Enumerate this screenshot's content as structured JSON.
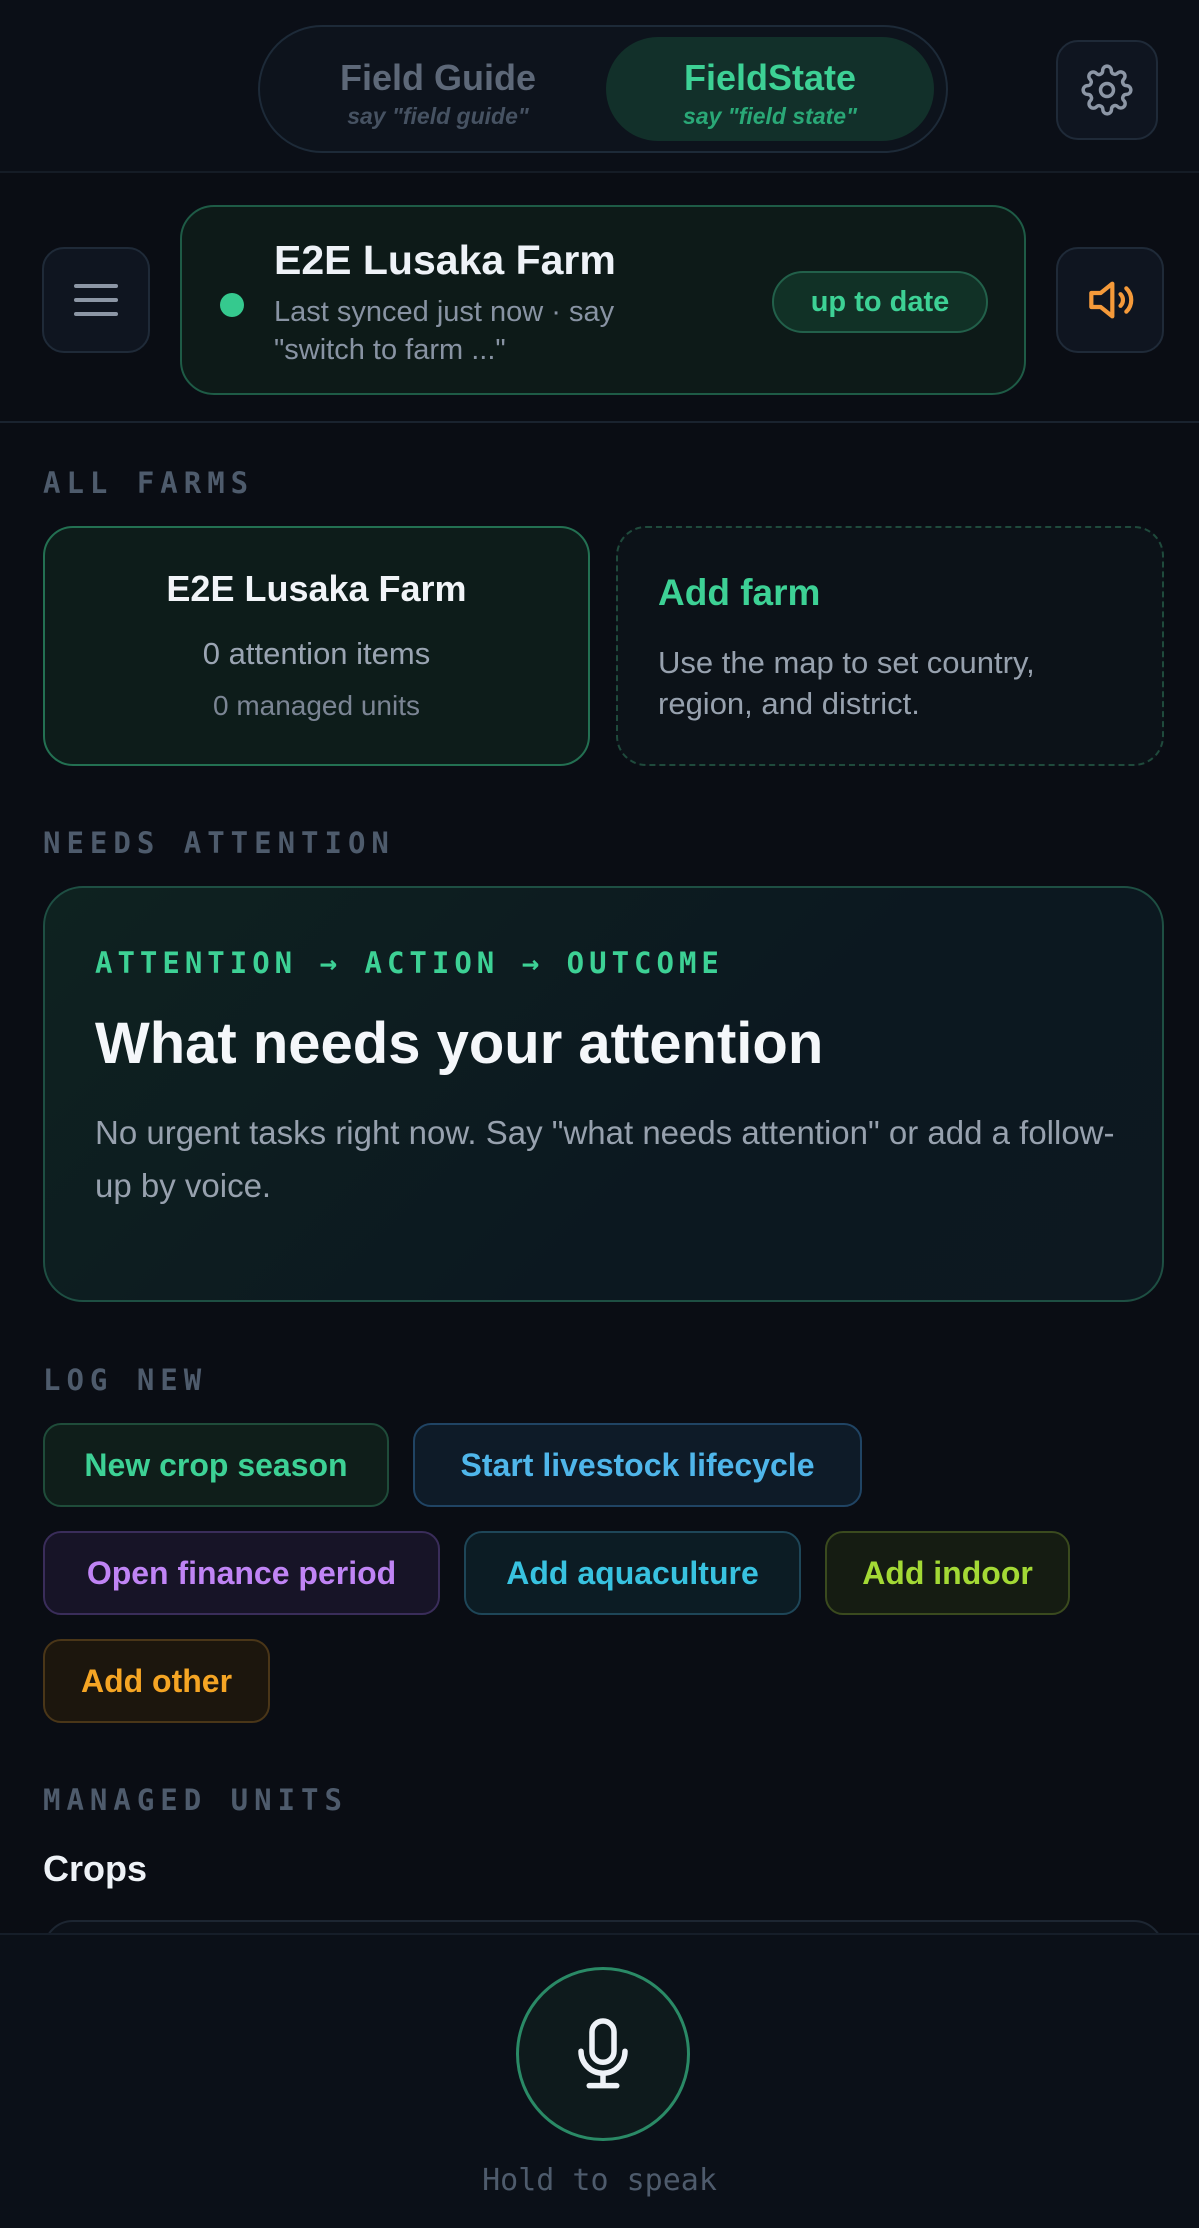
{
  "mode_toggle": {
    "field_guide": {
      "label": "Field Guide",
      "hint": "say \"field guide\""
    },
    "field_state": {
      "label": "FieldState",
      "hint": "say \"field state\""
    }
  },
  "farm_header": {
    "name": "E2E Lusaka Farm",
    "sync_text": "Last synced just now · say \"switch to farm ...\"",
    "status": "up to date"
  },
  "sections": {
    "all_farms": "ALL FARMS",
    "needs_attention": "NEEDS ATTENTION",
    "log_new": "LOG NEW",
    "managed_units": "MANAGED UNITS"
  },
  "farms": [
    {
      "name": "E2E Lusaka Farm",
      "attention": "0 attention items",
      "units": "0 managed units"
    }
  ],
  "add_farm": {
    "title": "Add farm",
    "description": "Use the map to set country, region, and district."
  },
  "attention": {
    "kicker": "ATTENTION → ACTION → OUTCOME",
    "title": "What needs your attention",
    "description": "No urgent tasks right now. Say \"what needs attention\" or add a follow-up by voice."
  },
  "log_new": {
    "crop": "New crop season",
    "livestock": "Start livestock lifecycle",
    "finance": "Open finance period",
    "aquaculture": "Add aquaculture",
    "indoor": "Add indoor",
    "other": "Add other"
  },
  "managed_units": {
    "crops_heading": "Crops"
  },
  "voice": {
    "hint": "Hold to speak"
  },
  "colors": {
    "accent_green": "#3dd195",
    "accent_orange": "#f59a3a",
    "background": "#0a0d14"
  },
  "icons": [
    "gear-icon",
    "hamburger-icon",
    "speaker-icon",
    "microphone-icon"
  ]
}
